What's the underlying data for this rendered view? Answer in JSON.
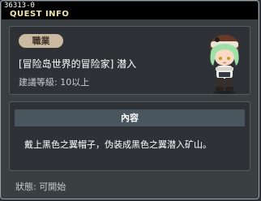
{
  "window": {
    "quest_id": "36313-0",
    "title": "QUEST INFO"
  },
  "summary": {
    "job_badge": "職業",
    "quest_name": "[冒险岛世界的冒险家] 潜入",
    "recommended_level": "建議等級: 10以上"
  },
  "details": {
    "section_title": "內容",
    "description": "戴上黑色之翼帽子，伪装成黑色之翼潜入矿山。"
  },
  "status": {
    "text": "狀態:  可開始"
  },
  "colors": {
    "title": "#f2e6a8",
    "badge": "#cbb9a1",
    "section_bar": "#4a565e"
  },
  "icons": {
    "portrait": "npc-portrait-green-hair"
  }
}
